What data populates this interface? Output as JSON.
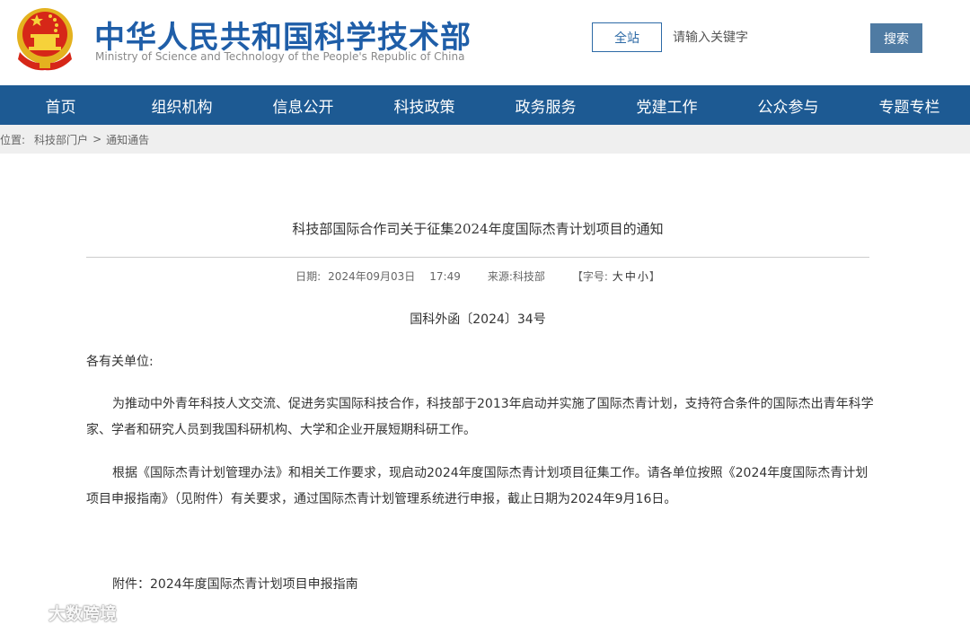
{
  "header": {
    "title": "中华人民共和国科学技术部",
    "subtitle": "Ministry of Science and Technology of the People's Republic of China",
    "emblem_icon": "national-emblem-icon"
  },
  "search": {
    "scope": "全站",
    "placeholder": "请输入关键字",
    "button": "搜索"
  },
  "nav": {
    "items": [
      "首页",
      "组织机构",
      "信息公开",
      "科技政策",
      "政务服务",
      "党建工作",
      "公众参与",
      "专题专栏"
    ]
  },
  "breadcrumb": {
    "prefix": "前位置:",
    "items": [
      "科技部门户",
      "通知通告"
    ],
    "separator": ">"
  },
  "article": {
    "title": "科技部国际合作司关于征集2024年度国际杰青计划项目的通知",
    "meta": {
      "date_label": "日期:",
      "date": "2024年09月03日",
      "time": "17:49",
      "source_label": "来源:",
      "source": "科技部",
      "font_label_open": "【字号:",
      "font_sizes": [
        "大",
        "中",
        "小"
      ],
      "font_label_close": "】"
    },
    "doc_number": "国科外函〔2024〕34号",
    "salutation": "各有关单位:",
    "paragraphs": [
      "为推动中外青年科技人文交流、促进务实国际科技合作，科技部于2013年启动并实施了国际杰青计划，支持符合条件的国际杰出青年科学家、学者和研究人员到我国科研机构、大学和企业开展短期科研工作。",
      "根据《国际杰青计划管理办法》和相关工作要求，现启动2024年度国际杰青计划项目征集工作。请各单位按照《2024年度国际杰青计划项目申报指南》（见附件）有关要求，通过国际杰青计划管理系统进行申报，截止日期为2024年9月16日。"
    ],
    "attachment": "附件：2024年度国际杰青计划项目申报指南"
  },
  "watermark": {
    "text": "大数跨境",
    "icon": "weibo-icon"
  },
  "colors": {
    "brand_blue": "#1f5ea8",
    "nav_bg": "#1d5a93",
    "search_button": "#4f7ba3"
  }
}
